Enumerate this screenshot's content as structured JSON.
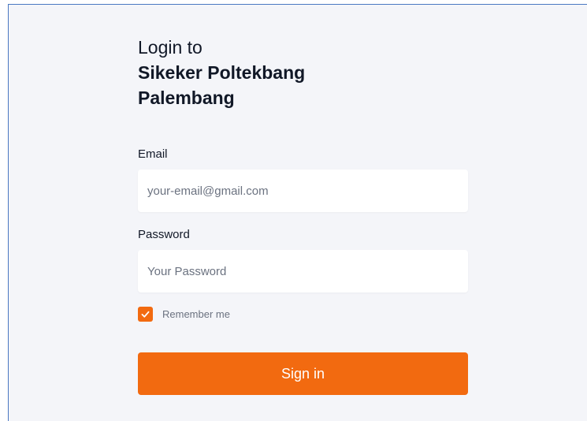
{
  "login": {
    "title_prefix": "Login to",
    "title_name_line1": "Sikeker Poltekbang",
    "title_name_line2": "Palembang",
    "email_label": "Email",
    "email_placeholder": "your-email@gmail.com",
    "email_value": "",
    "password_label": "Password",
    "password_placeholder": "Your Password",
    "password_value": "",
    "remember_label": "Remember me",
    "remember_checked": true,
    "signin_label": "Sign in"
  },
  "colors": {
    "accent": "#f26a10",
    "background": "#f4f5f9",
    "frame_border": "#4a78c2"
  },
  "icons": {
    "checkbox": "checkmark-icon"
  }
}
